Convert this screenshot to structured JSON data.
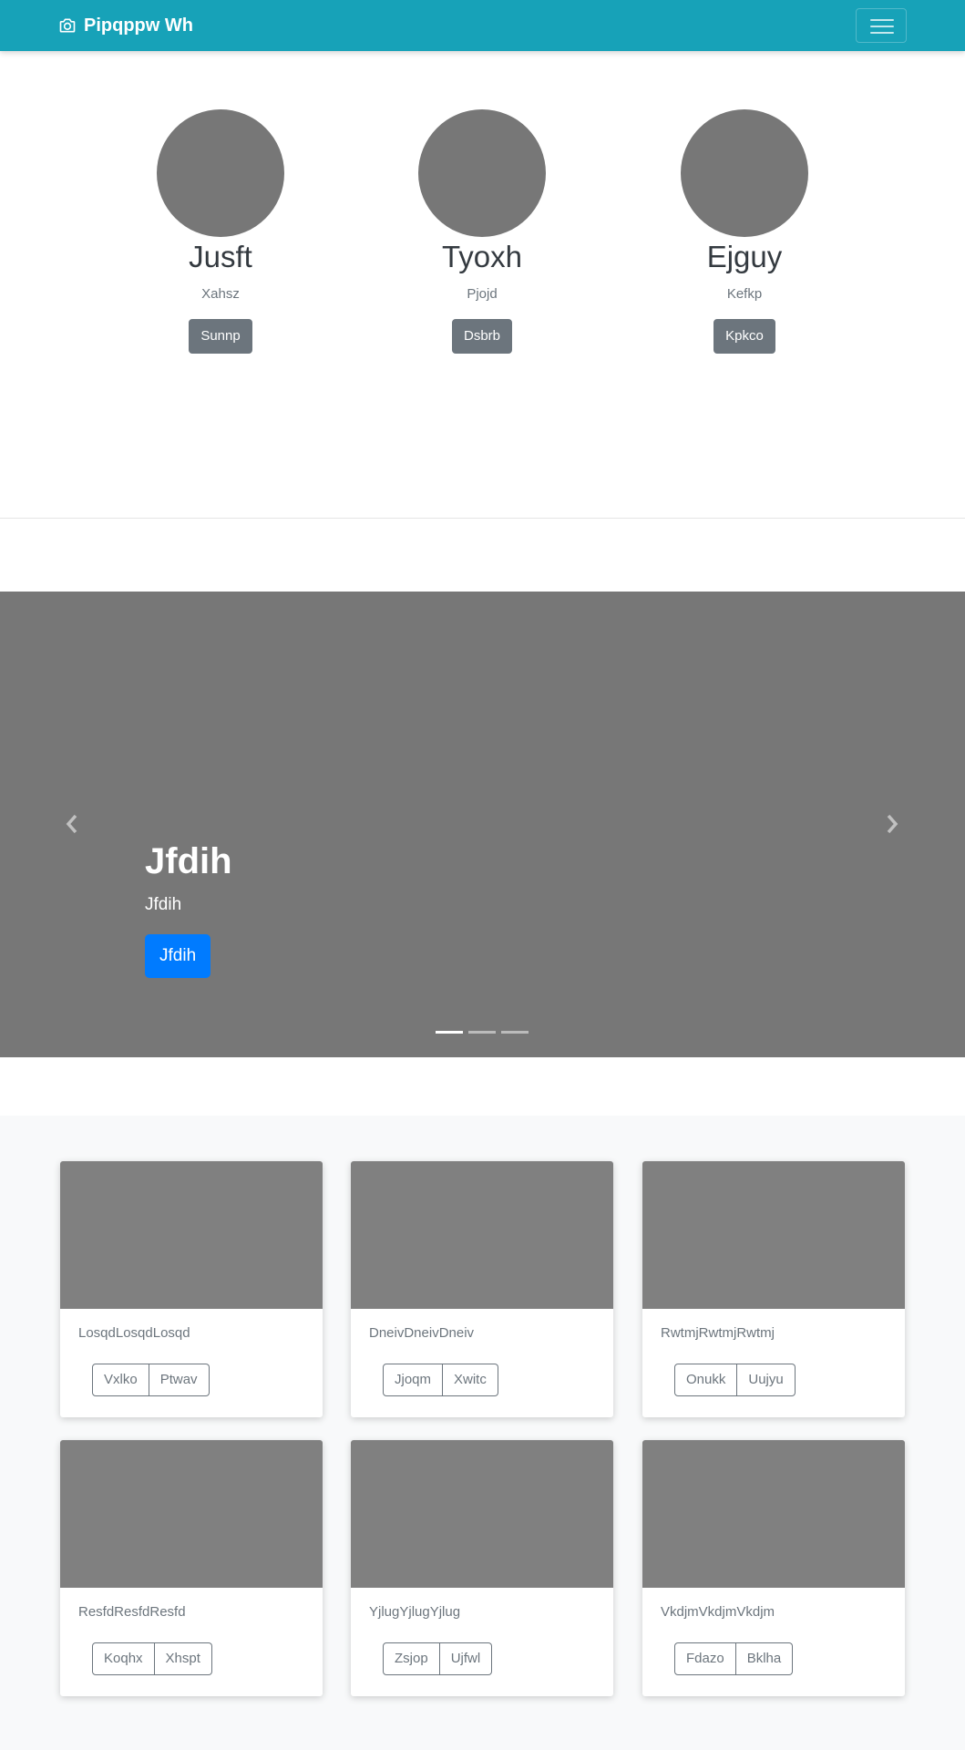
{
  "navbar": {
    "brand": "Pipqppw Wh",
    "brand_icon": "camera-icon",
    "toggler_icon": "hamburger-icon",
    "color": "#17a2b8"
  },
  "team": [
    {
      "name": "Jusft",
      "role": "Xahsz",
      "button": "Sunnp"
    },
    {
      "name": "Tyoxh",
      "role": "Pjojd",
      "button": "Dsbrb"
    },
    {
      "name": "Ejguy",
      "role": "Kefkp",
      "button": "Kpkco"
    }
  ],
  "carousel": {
    "title": "Jfdih",
    "subtitle": "Jfdih",
    "button": "Jfdih",
    "prev_icon": "chevron-left-icon",
    "next_icon": "chevron-right-icon",
    "slides": 3,
    "active_slide": 1
  },
  "cards": [
    {
      "text": "LosqdLosqdLosqd",
      "buttons": [
        "Vxlko",
        "Ptwav"
      ]
    },
    {
      "text": "DneivDneivDneiv",
      "buttons": [
        "Jjoqm",
        "Xwitc"
      ]
    },
    {
      "text": "RwtmjRwtmjRwtmj",
      "buttons": [
        "Onukk",
        "Uujyu"
      ]
    },
    {
      "text": "ResfdResfdResfd",
      "buttons": [
        "Koqhx",
        "Xhspt"
      ]
    },
    {
      "text": "YjlugYjlugYjlug",
      "buttons": [
        "Zsjop",
        "Ujfwl"
      ]
    },
    {
      "text": "VkdjmVkdjmVkdjm",
      "buttons": [
        "Fdazo",
        "Bklha"
      ]
    }
  ]
}
